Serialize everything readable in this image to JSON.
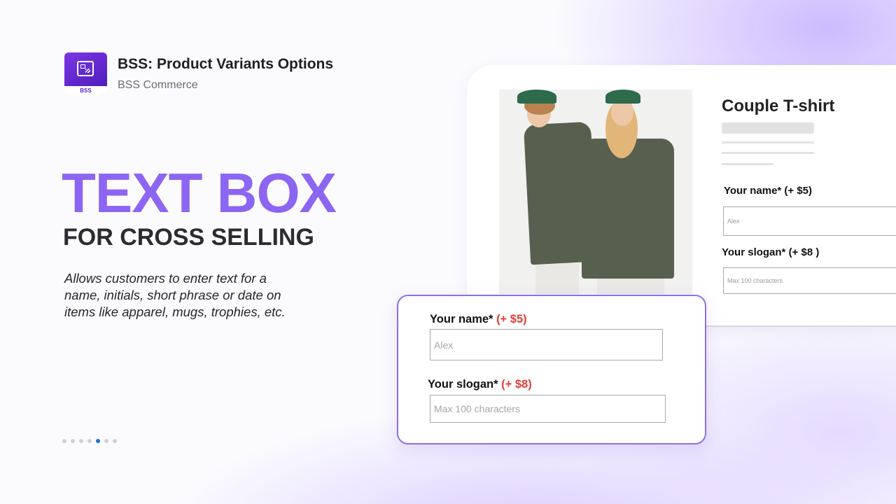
{
  "app": {
    "logo_text": "BSS",
    "title": "BSS: Product Variants Options",
    "vendor": "BSS Commerce"
  },
  "hero": {
    "headline": "TEXT BOX",
    "subheadline": "FOR CROSS SELLING",
    "description": "Allows customers to enter text for a name, initials, short phrase or date on items like apparel, mugs, trophies, etc."
  },
  "carousel": {
    "total": 7,
    "active_index": 4,
    "active_color": "#1f6fd6"
  },
  "product": {
    "title": "Couple T-shirt",
    "image_icon": "couple-tshirt-photo",
    "fields": [
      {
        "label": "Your name* (+ $5)",
        "placeholder": "Alex"
      },
      {
        "label": "Your slogan* (+ $8 )",
        "placeholder": "Max 100 characters"
      }
    ]
  },
  "form": {
    "fields": [
      {
        "label": "Your name*",
        "price": "(+ $5)",
        "placeholder": "Alex"
      },
      {
        "label": "Your slogan*",
        "price": "(+ $8)",
        "placeholder": "Max 100 characters"
      }
    ]
  },
  "colors": {
    "accent": "#8c66f2",
    "price": "#e03f38",
    "brand": "#5a23c8"
  }
}
